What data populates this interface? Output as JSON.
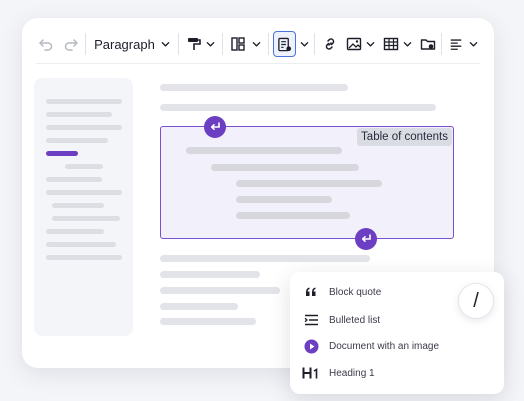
{
  "toolbar": {
    "paragraph_label": "Paragraph",
    "icons": [
      "undo-icon",
      "redo-icon",
      "paragraph-format-dropdown",
      "paint-format-icon",
      "layout-icon",
      "table-of-contents-icon",
      "link-icon",
      "image-icon",
      "table-icon",
      "insert-file-icon",
      "align-icon"
    ]
  },
  "toc": {
    "label": "Table of contents"
  },
  "menu": {
    "items": [
      {
        "label": "Block quote",
        "icon": "quote-icon"
      },
      {
        "label": "Bulleted list",
        "icon": "bulleted-list-icon"
      },
      {
        "label": "Document with an image",
        "icon": "play-icon"
      },
      {
        "label": "Heading 1",
        "icon": "heading-icon"
      }
    ]
  },
  "slash": {
    "label": "/"
  },
  "colors": {
    "accent": "#6c3ec1",
    "placeholder": "#e2e4e9",
    "toc_bg": "#f1f0fb"
  }
}
